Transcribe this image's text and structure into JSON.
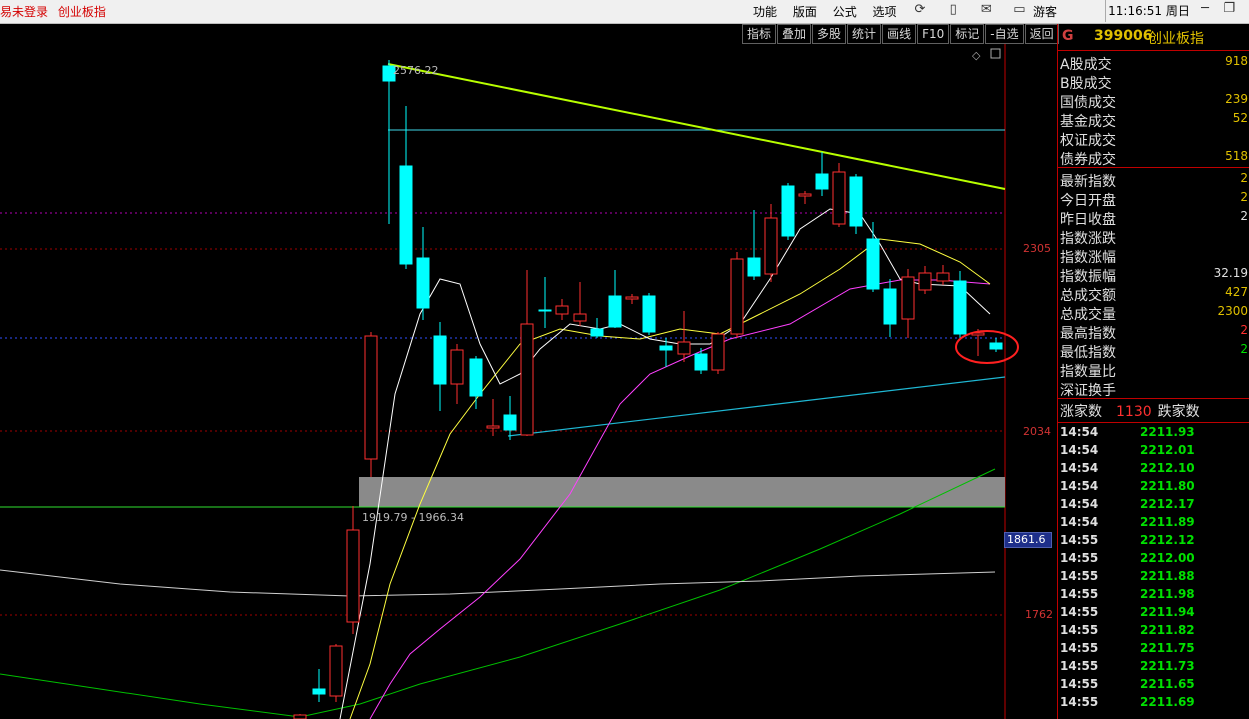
{
  "topbar": {
    "login_status": "易未登录",
    "board_name": "创业板指",
    "menu": [
      "功能",
      "版面",
      "公式",
      "选项"
    ],
    "tool_icons": [
      "refresh-icon",
      "phone-icon",
      "mail-icon",
      "monitor-icon"
    ],
    "guest": "游客",
    "clock": "11:16:51 周日",
    "window_controls": [
      "minimize-icon",
      "restore-icon",
      "close-icon"
    ]
  },
  "chart_toolbar": [
    "指标",
    "叠加",
    "多股",
    "统计",
    "画线",
    "F10",
    "标记",
    "-自选",
    "返回"
  ],
  "chart": {
    "peak_label": "2576.22",
    "zone_label": "1919.79 - 1966.34",
    "y_labels": [
      "2305",
      "2034",
      "1762"
    ],
    "current_price_tag": "1861.6",
    "colors": {
      "up": "#ff3030",
      "down": "#00ffff",
      "trendline_top": "#b8ff00",
      "trendline_bottom": "#1fb8d4",
      "zone": "#8a8a8a",
      "ma5": "#ffffff",
      "ma10": "#ffff40",
      "ma20": "#ff40ff",
      "ma60": "#00c000"
    }
  },
  "chart_data": {
    "type": "candlestick",
    "y_ticks": [
      2305,
      2034,
      1762
    ],
    "peak": 2576.22,
    "zone": [
      1919.79,
      1966.34
    ]
  },
  "panel": {
    "tag": "G",
    "code": "399006",
    "name": "创业板指",
    "trade_rows": [
      {
        "label": "A股成交",
        "value": "918"
      },
      {
        "label": "B股成交",
        "value": ""
      },
      {
        "label": "国债成交",
        "value": "239"
      },
      {
        "label": "基金成交",
        "value": "52"
      },
      {
        "label": "权证成交",
        "value": ""
      },
      {
        "label": "债券成交",
        "value": "518"
      }
    ],
    "index_rows": [
      {
        "label": "最新指数",
        "value": "2"
      },
      {
        "label": "今日开盘",
        "value": "2"
      },
      {
        "label": "昨日收盘",
        "value": "2"
      },
      {
        "label": "指数涨跌",
        "value": ""
      },
      {
        "label": "指数涨幅",
        "value": ""
      },
      {
        "label": "指数振幅",
        "value": "32.19"
      },
      {
        "label": "总成交额",
        "value": "427"
      },
      {
        "label": "总成交量",
        "value": "2300"
      },
      {
        "label": "最高指数",
        "value": "2"
      },
      {
        "label": "最低指数",
        "value": "2"
      },
      {
        "label": "指数量比",
        "value": ""
      },
      {
        "label": "深证换手",
        "value": ""
      }
    ],
    "advance_label": "涨家数",
    "advance_count": "1130",
    "decline_label": "跌家数",
    "ticks": [
      {
        "time": "14:54",
        "price": "2211.93"
      },
      {
        "time": "14:54",
        "price": "2212.01"
      },
      {
        "time": "14:54",
        "price": "2212.10"
      },
      {
        "time": "14:54",
        "price": "2211.80"
      },
      {
        "time": "14:54",
        "price": "2212.17"
      },
      {
        "time": "14:54",
        "price": "2211.89"
      },
      {
        "time": "14:55",
        "price": "2212.12"
      },
      {
        "time": "14:55",
        "price": "2212.00"
      },
      {
        "time": "14:55",
        "price": "2211.88"
      },
      {
        "time": "14:55",
        "price": "2211.98"
      },
      {
        "time": "14:55",
        "price": "2211.94"
      },
      {
        "time": "14:55",
        "price": "2211.82"
      },
      {
        "time": "14:55",
        "price": "2211.75"
      },
      {
        "time": "14:55",
        "price": "2211.73"
      },
      {
        "time": "14:55",
        "price": "2211.65"
      },
      {
        "time": "14:55",
        "price": "2211.69"
      }
    ]
  }
}
